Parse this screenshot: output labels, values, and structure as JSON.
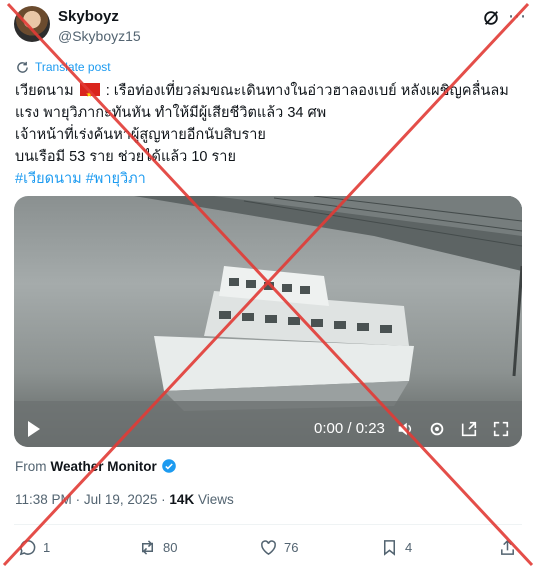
{
  "author": {
    "display_name": "Skyboyz",
    "handle": "@Skyboyz15"
  },
  "translate_label": "Translate post",
  "post": {
    "line1_prefix": "เวียดนาม",
    "line1_suffix": ": เรือท่องเที่ยวล่มขณะเดินทางในอ่าวฮาลองเบย์ หลังเผชิญคลื่นลม",
    "line2": "แรง พายุวิภากะทันหัน ทำให้มีผู้เสียชีวิตแล้ว 34 ศพ",
    "line3": "เจ้าหน้าที่เร่งค้นหาผู้สูญหายอีกนับสิบราย",
    "line4": "บนเรือมี 53 ราย ช่วยได้แล้ว 10 ราย",
    "hashtag1": "#เวียดนาม",
    "hashtag2": "#พายุวิภา"
  },
  "video": {
    "time": "0:00 / 0:23"
  },
  "source": {
    "prefix": "From",
    "name": "Weather Monitor"
  },
  "meta": {
    "time": "11:38 PM",
    "date": "Jul 19, 2025",
    "views_count": "14K",
    "views_label": "Views",
    "sep": "·"
  },
  "actions": {
    "replies": "1",
    "reposts": "80",
    "likes": "76",
    "bookmarks": "4"
  },
  "colors": {
    "accent": "#1d9bf0",
    "cross": "#e23b36",
    "muted": "#536471"
  },
  "icons": [
    "grok-icon",
    "more-icon",
    "translate-icon",
    "play-icon",
    "volume-icon",
    "settings-icon",
    "pip-icon",
    "fullscreen-icon",
    "verified-icon",
    "reply-icon",
    "repost-icon",
    "like-icon",
    "bookmark-icon",
    "share-icon"
  ]
}
